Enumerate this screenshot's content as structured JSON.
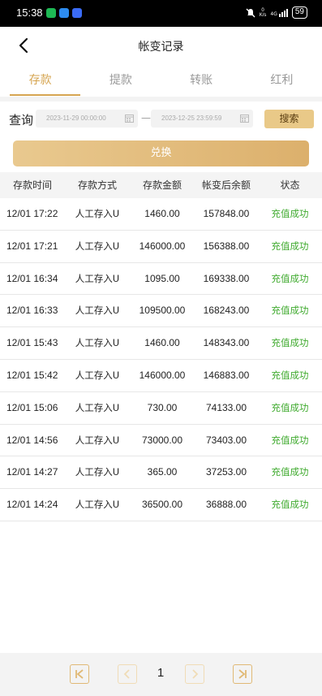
{
  "status_bar": {
    "time": "15:38",
    "network_speed_top": "0",
    "network_speed_bottom": "K/s",
    "signal": "4G",
    "battery": "59"
  },
  "header": {
    "title": "帐变记录",
    "back_icon": "chevron-left-icon"
  },
  "tabs": [
    {
      "label": "存款",
      "active": true
    },
    {
      "label": "提款",
      "active": false
    },
    {
      "label": "转账",
      "active": false
    },
    {
      "label": "红利",
      "active": false
    }
  ],
  "query": {
    "label": "查询",
    "start_date": "2023-11-29 00:00:00",
    "end_date": "2023-12-25 23:59:59",
    "separator": "—",
    "search_label": "搜索"
  },
  "exchange_label": "兑换",
  "table": {
    "headers": [
      "存款时间",
      "存款方式",
      "存款金额",
      "帐变后余额",
      "状态"
    ],
    "rows": [
      {
        "time": "12/01 17:22",
        "method": "人工存入U",
        "amount": "1460.00",
        "balance": "157848.00",
        "status": "充值成功"
      },
      {
        "time": "12/01 17:21",
        "method": "人工存入U",
        "amount": "146000.00",
        "balance": "156388.00",
        "status": "充值成功"
      },
      {
        "time": "12/01 16:34",
        "method": "人工存入U",
        "amount": "1095.00",
        "balance": "169338.00",
        "status": "充值成功"
      },
      {
        "time": "12/01 16:33",
        "method": "人工存入U",
        "amount": "109500.00",
        "balance": "168243.00",
        "status": "充值成功"
      },
      {
        "time": "12/01 15:43",
        "method": "人工存入U",
        "amount": "1460.00",
        "balance": "148343.00",
        "status": "充值成功"
      },
      {
        "time": "12/01 15:42",
        "method": "人工存入U",
        "amount": "146000.00",
        "balance": "146883.00",
        "status": "充值成功"
      },
      {
        "time": "12/01 15:06",
        "method": "人工存入U",
        "amount": "730.00",
        "balance": "74133.00",
        "status": "充值成功"
      },
      {
        "time": "12/01 14:56",
        "method": "人工存入U",
        "amount": "73000.00",
        "balance": "73403.00",
        "status": "充值成功"
      },
      {
        "time": "12/01 14:27",
        "method": "人工存入U",
        "amount": "365.00",
        "balance": "37253.00",
        "status": "充值成功"
      },
      {
        "time": "12/01 14:24",
        "method": "人工存入U",
        "amount": "36500.00",
        "balance": "36888.00",
        "status": "充值成功"
      }
    ]
  },
  "pagination": {
    "current_page": "1"
  },
  "colors": {
    "accent": "#d6a551",
    "success": "#3faa2e",
    "button": "#e9c988"
  }
}
